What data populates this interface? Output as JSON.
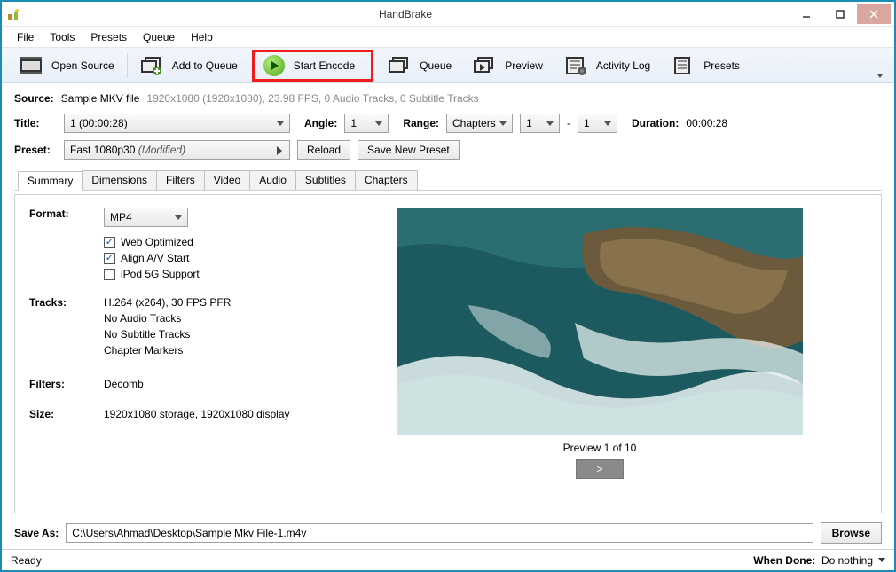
{
  "window": {
    "title": "HandBrake"
  },
  "menu": {
    "items": [
      "File",
      "Tools",
      "Presets",
      "Queue",
      "Help"
    ]
  },
  "toolbar": {
    "open_source": "Open Source",
    "add_to_queue": "Add to Queue",
    "start_encode": "Start Encode",
    "queue": "Queue",
    "preview": "Preview",
    "activity_log": "Activity Log",
    "presets": "Presets"
  },
  "source": {
    "label": "Source:",
    "name": "Sample MKV file",
    "info": "1920x1080 (1920x1080), 23.98 FPS, 0 Audio Tracks, 0 Subtitle Tracks"
  },
  "title_row": {
    "label": "Title:",
    "title_value": "1 (00:00:28)",
    "angle_label": "Angle:",
    "angle_value": "1",
    "range_label": "Range:",
    "range_type": "Chapters",
    "range_from": "1",
    "range_dash": "-",
    "range_to": "1",
    "duration_label": "Duration:",
    "duration_value": "00:00:28"
  },
  "preset_row": {
    "label": "Preset:",
    "value": "Fast 1080p30",
    "modified": " (Modified)",
    "reload": "Reload",
    "save_new": "Save New Preset"
  },
  "tabs": [
    "Summary",
    "Dimensions",
    "Filters",
    "Video",
    "Audio",
    "Subtitles",
    "Chapters"
  ],
  "summary": {
    "format_label": "Format:",
    "format_value": "MP4",
    "web_optimized": "Web Optimized",
    "align_av": "Align A/V Start",
    "ipod": "iPod 5G Support",
    "tracks_label": "Tracks:",
    "tracks_lines": [
      "H.264 (x264), 30 FPS PFR",
      "No Audio Tracks",
      "No Subtitle Tracks",
      "Chapter Markers"
    ],
    "filters_label": "Filters:",
    "filters_value": "Decomb",
    "size_label": "Size:",
    "size_value": "1920x1080 storage, 1920x1080 display",
    "preview_caption": "Preview 1 of 10",
    "preview_next": ">"
  },
  "save_as": {
    "label": "Save As:",
    "path": "C:\\Users\\Ahmad\\Desktop\\Sample Mkv File-1.m4v",
    "browse": "Browse"
  },
  "status": {
    "ready": "Ready",
    "when_done_label": "When Done:",
    "when_done_value": "Do nothing"
  }
}
